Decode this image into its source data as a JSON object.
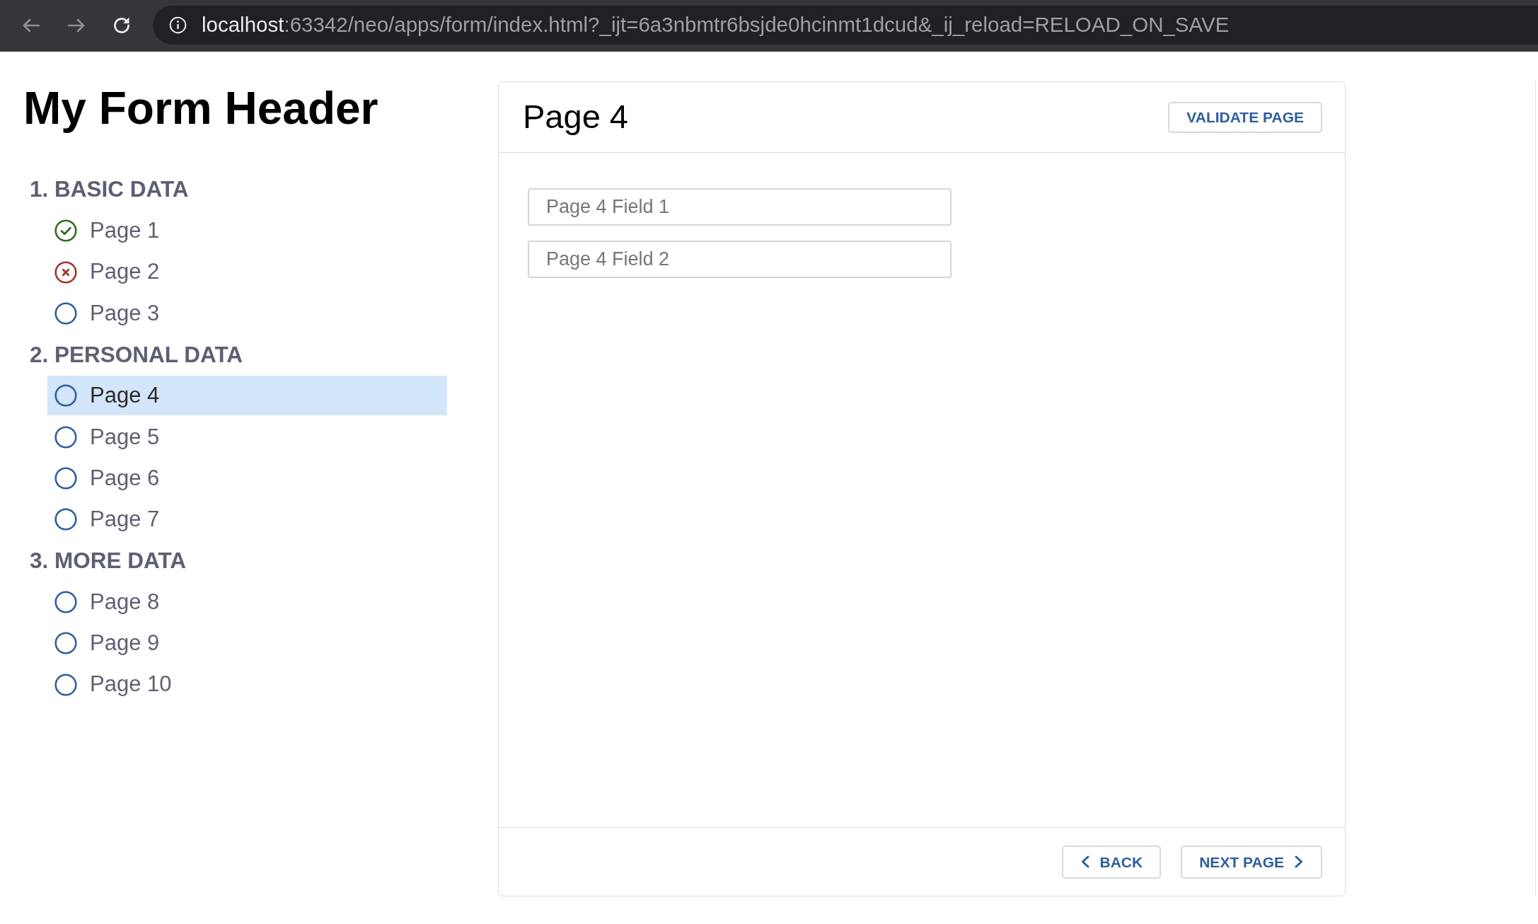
{
  "browser": {
    "back_disabled": true,
    "forward_disabled": true,
    "url": {
      "host": "localhost",
      "path": ":63342/neo/apps/form/index.html?_ijt=6a3nbmtr6bsjde0hcinmt1dcud&_ij_reload=RELOAD_ON_SAVE"
    }
  },
  "form_header": "My Form Header",
  "sections": [
    {
      "title": "1. BASIC DATA",
      "pages": [
        {
          "label": "Page 1",
          "kind": "valid",
          "selected": false
        },
        {
          "label": "Page 2",
          "kind": "invalid",
          "selected": false
        },
        {
          "label": "Page 3",
          "kind": "open",
          "selected": false
        }
      ]
    },
    {
      "title": "2. PERSONAL DATA",
      "pages": [
        {
          "label": "Page 4",
          "kind": "open",
          "selected": true
        },
        {
          "label": "Page 5",
          "kind": "open",
          "selected": false
        },
        {
          "label": "Page 6",
          "kind": "open",
          "selected": false
        },
        {
          "label": "Page 7",
          "kind": "open",
          "selected": false
        }
      ]
    },
    {
      "title": "3. MORE DATA",
      "pages": [
        {
          "label": "Page 8",
          "kind": "open",
          "selected": false
        },
        {
          "label": "Page 9",
          "kind": "open",
          "selected": false
        },
        {
          "label": "Page 10",
          "kind": "open",
          "selected": false
        }
      ]
    }
  ],
  "page": {
    "title": "Page 4",
    "validate_button": "VALIDATE PAGE",
    "fields": [
      {
        "placeholder": "Page 4 Field 1"
      },
      {
        "placeholder": "Page 4 Field 2"
      }
    ],
    "back_button": "BACK",
    "next_button": "NEXT PAGE"
  }
}
